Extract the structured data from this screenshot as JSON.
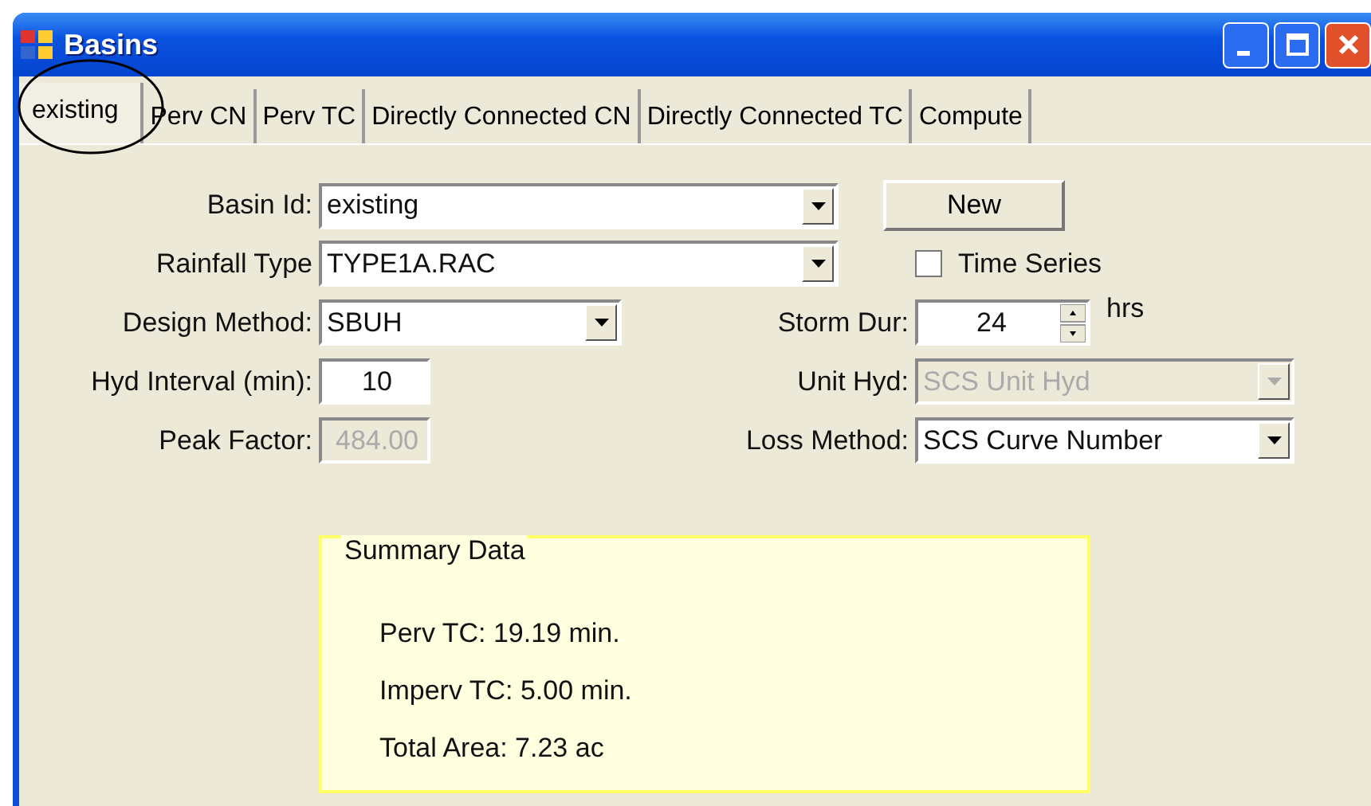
{
  "window": {
    "title": "Basins"
  },
  "tabs": [
    {
      "label": "existing",
      "selected": true
    },
    {
      "label": "Perv CN",
      "selected": false
    },
    {
      "label": "Perv TC",
      "selected": false
    },
    {
      "label": "Directly Connected CN",
      "selected": false
    },
    {
      "label": "Directly Connected TC",
      "selected": false
    },
    {
      "label": "Compute",
      "selected": false
    }
  ],
  "form": {
    "rows": [
      {
        "left": {
          "kind": "combo",
          "label": "Basin Id:",
          "value": "existing",
          "disabled": false
        },
        "right": {
          "kind": "button",
          "label": "New"
        }
      },
      {
        "left": {
          "kind": "combo",
          "label": "Rainfall Type",
          "value": "TYPE1A.RAC",
          "disabled": false
        },
        "right": {
          "kind": "checkbox",
          "label": "Time Series",
          "checked": false
        }
      },
      {
        "left": {
          "kind": "combo",
          "label": "Design Method:",
          "value": "SBUH",
          "disabled": false
        },
        "right": {
          "kind": "spin",
          "label": "Storm Dur:",
          "value": "24",
          "unit": "hrs"
        }
      },
      {
        "left": {
          "kind": "text",
          "label": "Hyd Interval (min):",
          "value": "10",
          "disabled": false
        },
        "right": {
          "kind": "combo",
          "label": "Unit Hyd:",
          "value": "SCS Unit Hyd",
          "disabled": true
        }
      },
      {
        "left": {
          "kind": "text",
          "label": "Peak Factor:",
          "value": "484.00",
          "disabled": true
        },
        "right": {
          "kind": "combo",
          "label": "Loss Method:",
          "value": "SCS Curve Number",
          "disabled": false
        }
      }
    ]
  },
  "summary": {
    "title": "Summary Data",
    "lines": [
      "Perv TC: 19.19 min.",
      "Imperv TC: 5.00 min.",
      "Total Area: 7.23 ac"
    ]
  }
}
